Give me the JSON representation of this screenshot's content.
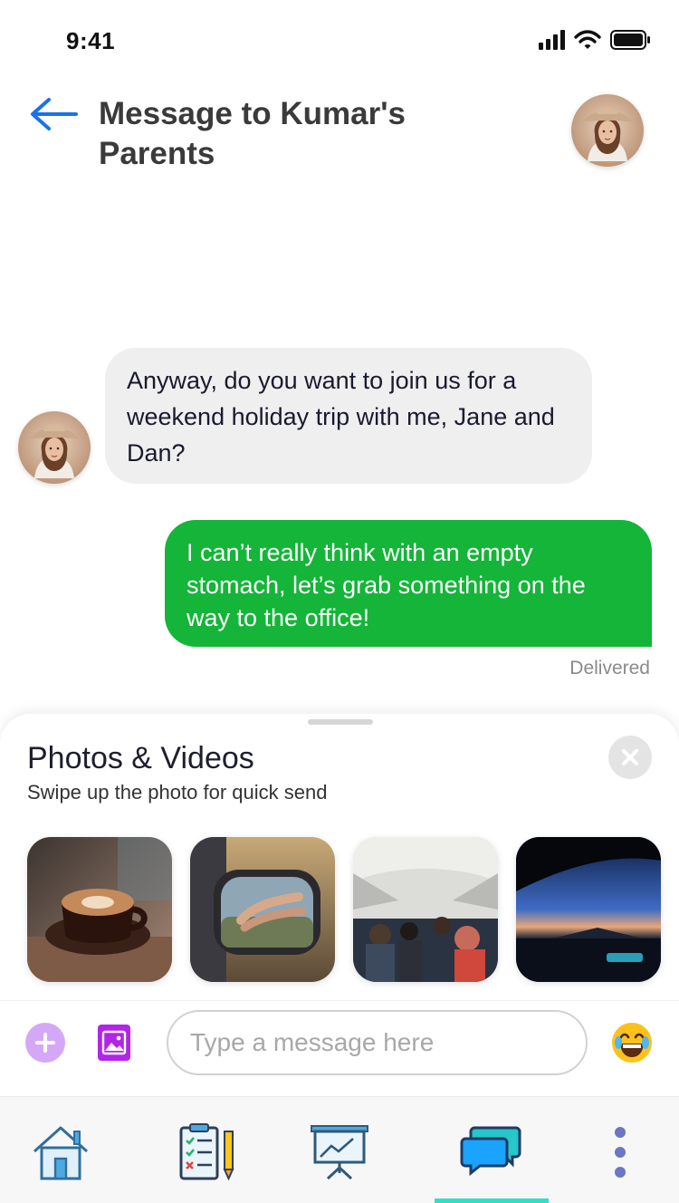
{
  "status_bar": {
    "time": "9:41",
    "icons": [
      "signal-icon",
      "wifi-icon",
      "battery-icon"
    ]
  },
  "header": {
    "title": "Message to Kumar's Parents",
    "back_icon": "back-arrow-icon",
    "avatar": "profile-avatar"
  },
  "messages": [
    {
      "direction": "incoming",
      "text": "Anyway, do you want to join us for a weekend holiday trip with me, Jane and Dan?"
    },
    {
      "direction": "outgoing",
      "text": "I can’t really think with an empty stomach, let’s grab something on the way to the office!",
      "status": "Delivered"
    }
  ],
  "media_sheet": {
    "title": "Photos & Videos",
    "subtitle": "Swipe up the photo for quick send",
    "photos": [
      "coffee-cup-photo",
      "car-mirror-photo",
      "airplane-cabin-photo",
      "night-road-photo"
    ]
  },
  "composer": {
    "placeholder": "Type a message here",
    "value": ""
  },
  "tabbar": {
    "tabs": [
      "home-icon",
      "checklist-icon",
      "presentation-icon",
      "chat-icon",
      "more-icon"
    ],
    "active": "chat-icon"
  },
  "colors": {
    "accent_blue": "#1a73e8",
    "outgoing_bubble": "#14b538",
    "incoming_bubble": "#efefef",
    "tab_indicator": "#2ee1c3",
    "plus_button": "#d5a8f7",
    "gallery_button": "#b125e8"
  }
}
